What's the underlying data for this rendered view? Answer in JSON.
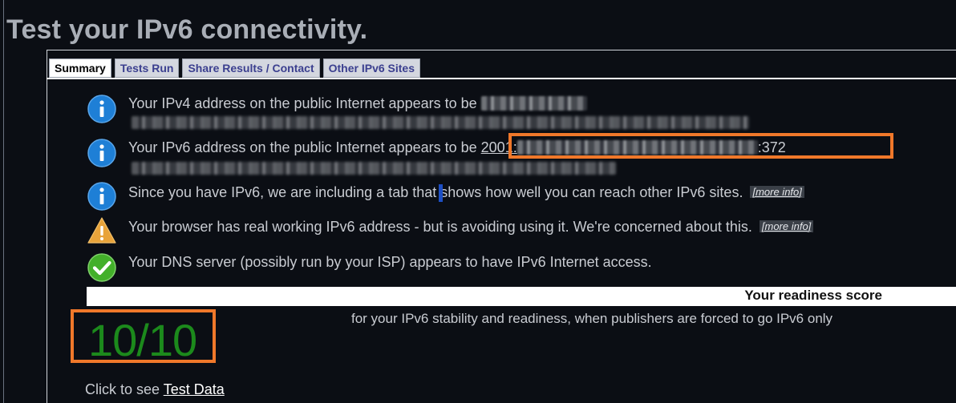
{
  "page_title": "Test your IPv6 connectivity.",
  "tabs": [
    {
      "label": "Summary",
      "active": true
    },
    {
      "label": "Tests Run",
      "active": false
    },
    {
      "label": "Share Results / Contact",
      "active": false
    },
    {
      "label": "Other IPv6 Sites",
      "active": false
    }
  ],
  "messages": [
    {
      "icon": "info-icon",
      "text": "Your IPv4 address on the public Internet appears to be"
    },
    {
      "icon": "info-icon",
      "text": "Your IPv6 address on the public Internet appears to be",
      "ipv6_prefix": "2001:",
      "ipv6_suffix": ":372"
    },
    {
      "icon": "info-icon",
      "text_before": "Since you have IPv6, we are including a tab",
      "text_after": "that shows how well you can reach other IPv6 sites.",
      "link": "[more info]"
    },
    {
      "icon": "warning-icon",
      "text": "Your browser has real working IPv6 address - but is avoiding using it. We're concerned about this.",
      "link": "[more info]"
    },
    {
      "icon": "check-icon",
      "text": "Your DNS server (possibly run by your ISP) appears to have IPv6 Internet access."
    }
  ],
  "score": {
    "label": "Your readiness score",
    "subtitle": "for your IPv6 stability and readiness, when publishers are forced to go IPv6 only",
    "value": "10/10"
  },
  "test_data": {
    "prefix": "Click to see ",
    "link": "Test Data"
  },
  "colors": {
    "background": "#0b0e14",
    "info": "#1e7fd6",
    "warning": "#e8a33a",
    "success": "#43b02a",
    "score": "#1c8a1c",
    "highlight": "#f0782a"
  }
}
